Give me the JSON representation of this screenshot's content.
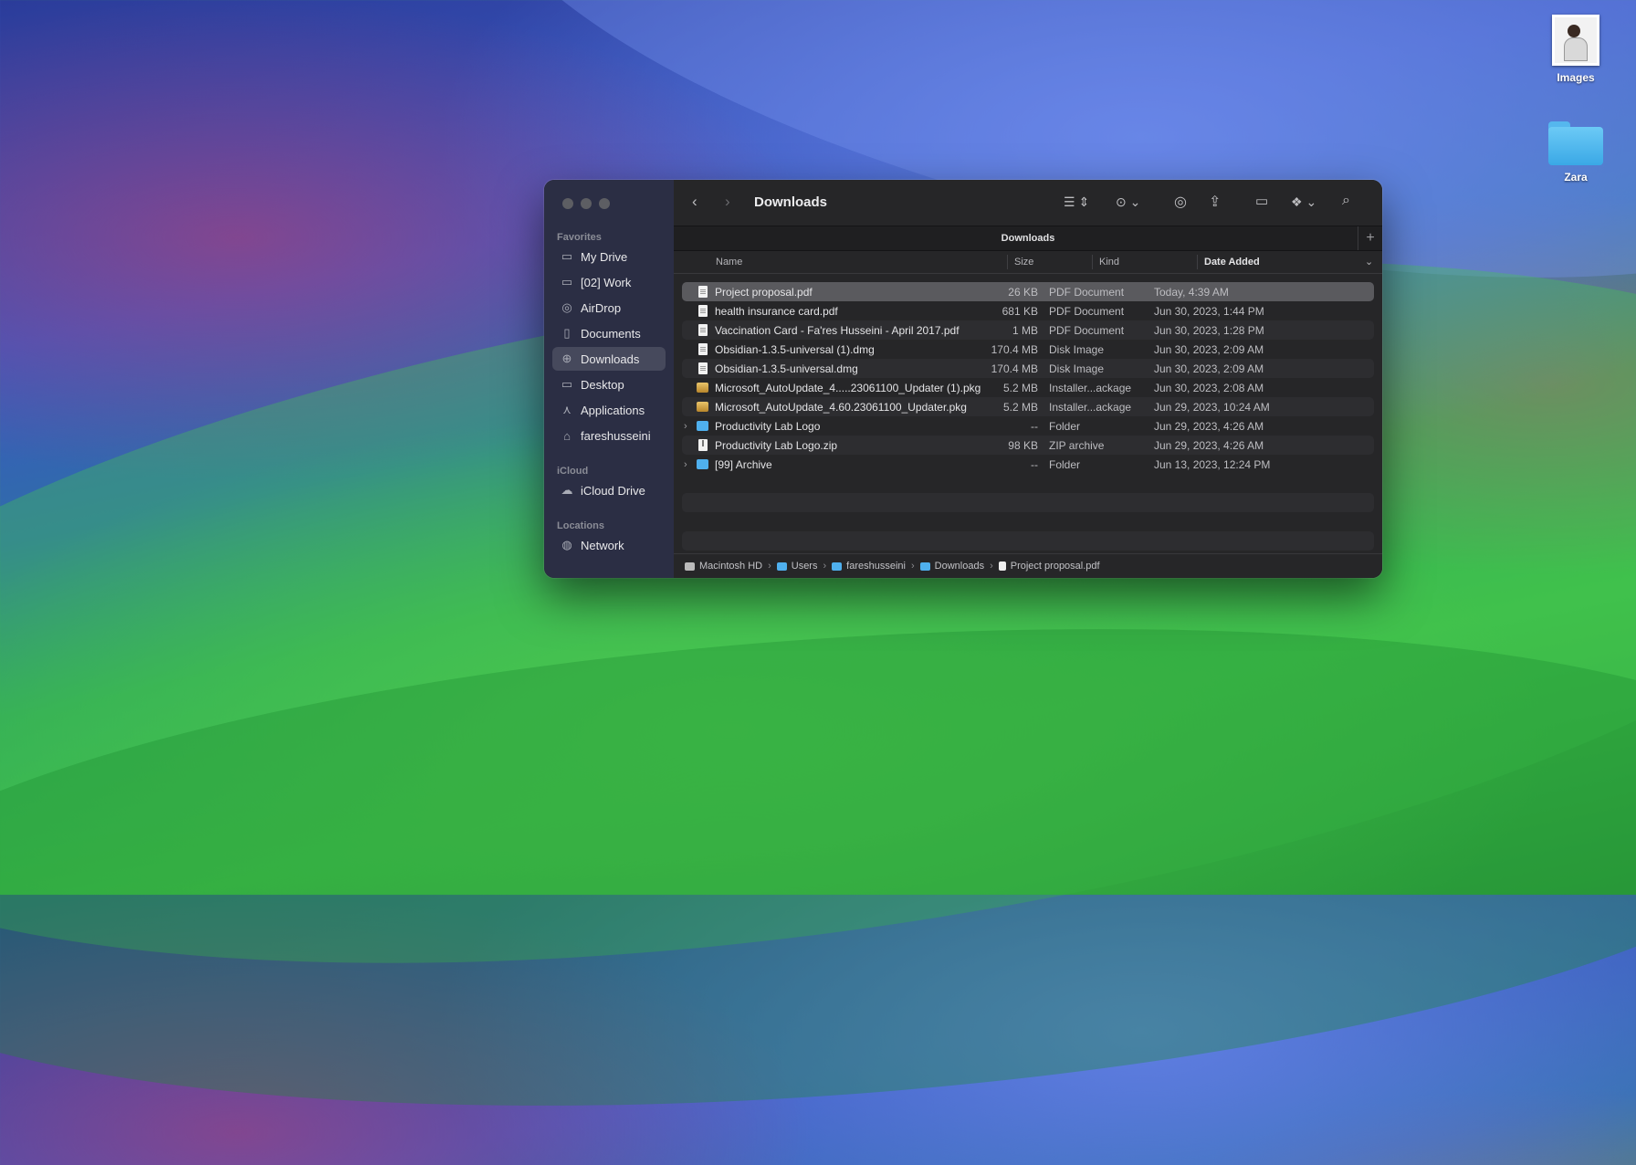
{
  "desktop": {
    "icons": [
      {
        "label": "Images",
        "icon": "photo-thumbnail-icon"
      },
      {
        "label": "Zara",
        "icon": "folder-icon"
      }
    ]
  },
  "finder": {
    "title": "Downloads",
    "tab_label": "Downloads",
    "sidebar": {
      "favorites_header": "Favorites",
      "favorites": [
        {
          "label": "My Drive",
          "icon": "folder-icon"
        },
        {
          "label": "[02] Work",
          "icon": "folder-icon"
        },
        {
          "label": "AirDrop",
          "icon": "airdrop-icon"
        },
        {
          "label": "Documents",
          "icon": "document-icon"
        },
        {
          "label": "Downloads",
          "icon": "download-icon",
          "active": true
        },
        {
          "label": "Desktop",
          "icon": "desktop-icon"
        },
        {
          "label": "Applications",
          "icon": "applications-icon"
        },
        {
          "label": "fareshusseini",
          "icon": "home-icon"
        }
      ],
      "icloud_header": "iCloud",
      "icloud": [
        {
          "label": "iCloud Drive",
          "icon": "cloud-icon"
        }
      ],
      "locations_header": "Locations",
      "locations": [
        {
          "label": "Network",
          "icon": "network-icon"
        }
      ]
    },
    "columns": {
      "name": "Name",
      "size": "Size",
      "kind": "Kind",
      "date": "Date Added"
    },
    "files": [
      {
        "name": "Project proposal.pdf",
        "size": "26 KB",
        "kind": "PDF Document",
        "date": "Today, 4:39 AM",
        "type": "doc",
        "selected": true
      },
      {
        "name": "health insurance card.pdf",
        "size": "681 KB",
        "kind": "PDF Document",
        "date": "Jun 30, 2023, 1:44 PM",
        "type": "doc"
      },
      {
        "name": "Vaccination Card - Fa'res Husseini - April 2017.pdf",
        "size": "1 MB",
        "kind": "PDF Document",
        "date": "Jun 30, 2023, 1:28 PM",
        "type": "doc"
      },
      {
        "name": "Obsidian-1.3.5-universal (1).dmg",
        "size": "170.4 MB",
        "kind": "Disk Image",
        "date": "Jun 30, 2023, 2:09 AM",
        "type": "doc"
      },
      {
        "name": "Obsidian-1.3.5-universal.dmg",
        "size": "170.4 MB",
        "kind": "Disk Image",
        "date": "Jun 30, 2023, 2:09 AM",
        "type": "doc"
      },
      {
        "name": "Microsoft_AutoUpdate_4.....23061100_Updater (1).pkg",
        "size": "5.2 MB",
        "kind": "Installer...ackage",
        "date": "Jun 30, 2023, 2:08 AM",
        "type": "pkg"
      },
      {
        "name": "Microsoft_AutoUpdate_4.60.23061100_Updater.pkg",
        "size": "5.2 MB",
        "kind": "Installer...ackage",
        "date": "Jun 29, 2023, 10:24 AM",
        "type": "pkg"
      },
      {
        "name": "Productivity Lab Logo",
        "size": "--",
        "kind": "Folder",
        "date": "Jun 29, 2023, 4:26 AM",
        "type": "folder"
      },
      {
        "name": "Productivity Lab Logo.zip",
        "size": "98 KB",
        "kind": "ZIP archive",
        "date": "Jun 29, 2023, 4:26 AM",
        "type": "zip"
      },
      {
        "name": "[99] Archive",
        "size": "--",
        "kind": "Folder",
        "date": "Jun 13, 2023, 12:24 PM",
        "type": "folder"
      }
    ],
    "path": [
      {
        "label": "Macintosh HD",
        "icon": "disk-icon"
      },
      {
        "label": "Users",
        "icon": "folder-icon"
      },
      {
        "label": "fareshusseini",
        "icon": "folder-icon"
      },
      {
        "label": "Downloads",
        "icon": "folder-icon"
      },
      {
        "label": "Project proposal.pdf",
        "icon": "document-icon"
      }
    ]
  }
}
